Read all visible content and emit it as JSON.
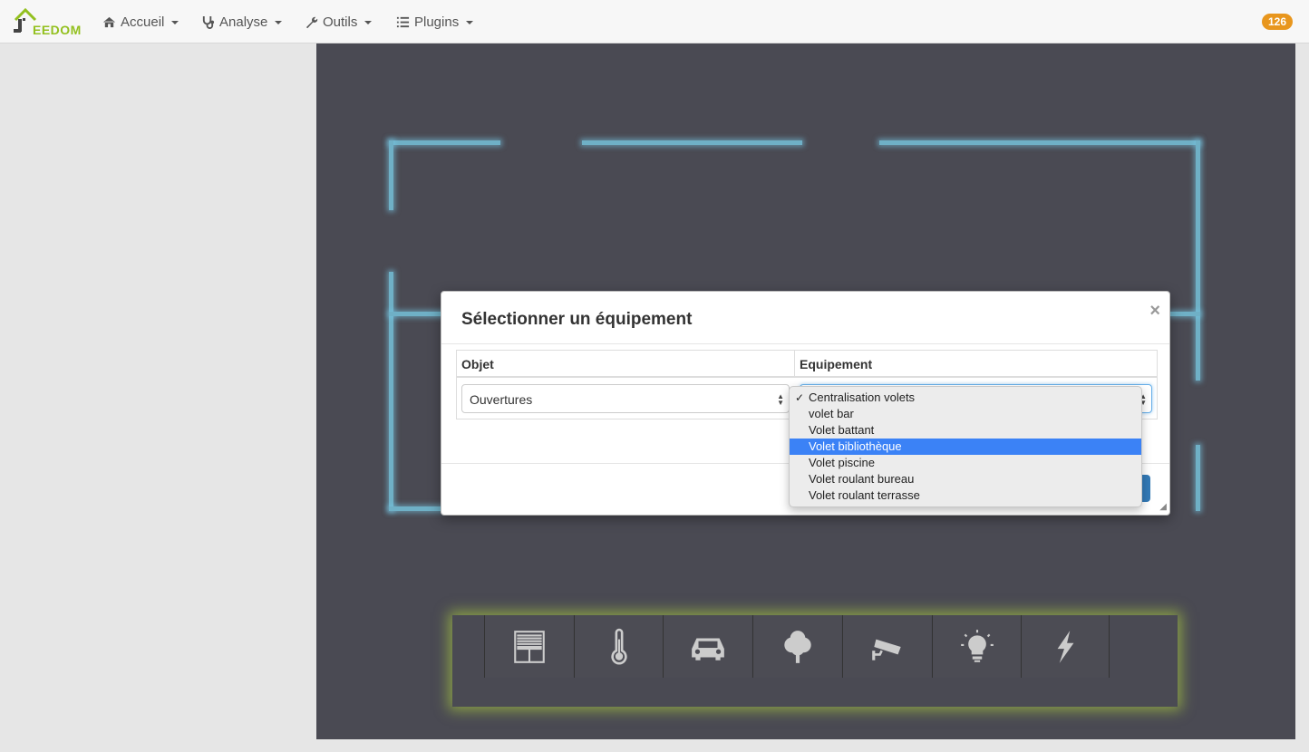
{
  "navbar": {
    "logo_text": "EEDOM",
    "items": [
      {
        "label": "Accueil",
        "icon": "home-icon"
      },
      {
        "label": "Analyse",
        "icon": "stethoscope-icon"
      },
      {
        "label": "Outils",
        "icon": "wrench-icon"
      },
      {
        "label": "Plugins",
        "icon": "list-icon"
      }
    ],
    "badge": "126"
  },
  "modal": {
    "title": "Sélectionner un équipement",
    "close": "×",
    "col_object": "Objet",
    "col_equipment": "Equipement",
    "object_value": "Ouvertures",
    "equipment_value": "Centralisation volets"
  },
  "dropdown": {
    "options": [
      {
        "label": "Centralisation volets",
        "checked": true
      },
      {
        "label": "volet bar"
      },
      {
        "label": "Volet battant"
      },
      {
        "label": "Volet bibliothèque",
        "highlighted": true
      },
      {
        "label": "Volet piscine"
      },
      {
        "label": "Volet roulant bureau"
      },
      {
        "label": "Volet roulant terrasse"
      }
    ],
    "check_mark": "✓"
  },
  "iconbar": {
    "icons": [
      "shutter-icon",
      "thermometer-icon",
      "car-icon",
      "tree-icon",
      "camera-icon",
      "lightbulb-icon",
      "lightning-icon"
    ]
  },
  "colors": {
    "plan_bg": "#4a4a53",
    "wall": "#6fb0c6",
    "accent": "#337ab7",
    "badge": "#e8961d",
    "highlight": "#3b82f6"
  }
}
